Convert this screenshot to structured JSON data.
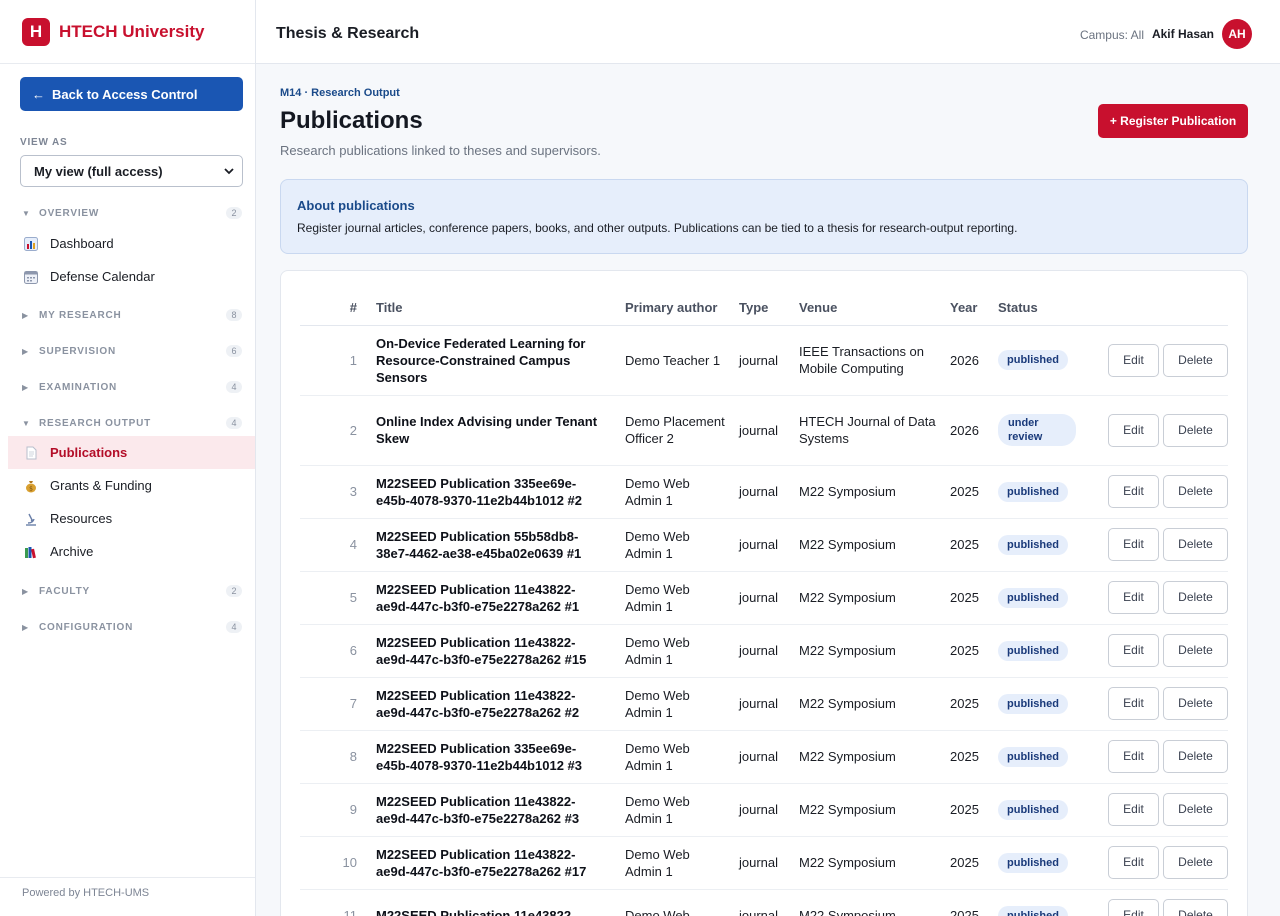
{
  "brand": {
    "logo_letter": "H",
    "name": "HTECH University"
  },
  "sidebar": {
    "back_label": "Back to Access Control",
    "back_arrow": "←",
    "view_as_label": "VIEW AS",
    "view_as_value": "My view (full access)",
    "groups": {
      "overview": {
        "label": "OVERVIEW",
        "count": "2",
        "expanded": true
      },
      "my_research": {
        "label": "MY RESEARCH",
        "count": "8",
        "expanded": false
      },
      "supervision": {
        "label": "SUPERVISION",
        "count": "6",
        "expanded": false
      },
      "examination": {
        "label": "EXAMINATION",
        "count": "4",
        "expanded": false
      },
      "research_output": {
        "label": "RESEARCH OUTPUT",
        "count": "4",
        "expanded": true
      },
      "faculty": {
        "label": "FACULTY",
        "count": "2",
        "expanded": false
      },
      "configuration": {
        "label": "CONFIGURATION",
        "count": "4",
        "expanded": false
      }
    },
    "items": {
      "dashboard": {
        "label": "Dashboard",
        "icon": "bar-chart-icon"
      },
      "defense_calendar": {
        "label": "Defense Calendar",
        "icon": "calendar-icon"
      },
      "publications": {
        "label": "Publications",
        "icon": "document-icon",
        "active": true
      },
      "grants": {
        "label": "Grants & Funding",
        "icon": "money-bag-icon"
      },
      "resources": {
        "label": "Resources",
        "icon": "microscope-icon"
      },
      "archive": {
        "label": "Archive",
        "icon": "books-icon"
      }
    },
    "powered_by": "Powered by HTECH-UMS"
  },
  "topbar": {
    "title": "Thesis & Research",
    "campus": "Campus: All",
    "user_name": "Akif Hasan",
    "avatar_initials": "AH"
  },
  "page": {
    "breadcrumb": "M14 · Research Output",
    "title": "Publications",
    "subtitle": "Research publications linked to theses and supervisors.",
    "register_label": "+ Register Publication"
  },
  "info": {
    "title": "About publications",
    "text": "Register journal articles, conference papers, books, and other outputs. Publications can be tied to a thesis for research-output reporting."
  },
  "table": {
    "headers": {
      "num": "#",
      "title": "Title",
      "author": "Primary author",
      "type": "Type",
      "venue": "Venue",
      "year": "Year",
      "status": "Status"
    },
    "edit_label": "Edit",
    "delete_label": "Delete",
    "rows": [
      {
        "num": "1",
        "title": "On-Device Federated Learning for Resource-Constrained Campus Sensors",
        "author": "Demo Teacher 1",
        "type": "journal",
        "venue": "IEEE Transactions on Mobile Computing",
        "year": "2026",
        "status": "published"
      },
      {
        "num": "2",
        "title": "Online Index Advising under Tenant Skew",
        "author": "Demo Placement Officer 2",
        "type": "journal",
        "venue": "HTECH Journal of Data Systems",
        "year": "2026",
        "status": "under review"
      },
      {
        "num": "3",
        "title": "M22SEED Publication 335ee69e-e45b-4078-9370-11e2b44b1012 #2",
        "author": "Demo Web Admin 1",
        "type": "journal",
        "venue": "M22 Symposium",
        "year": "2025",
        "status": "published"
      },
      {
        "num": "4",
        "title": "M22SEED Publication 55b58db8-38e7-4462-ae38-e45ba02e0639 #1",
        "author": "Demo Web Admin 1",
        "type": "journal",
        "venue": "M22 Symposium",
        "year": "2025",
        "status": "published"
      },
      {
        "num": "5",
        "title": "M22SEED Publication 11e43822-ae9d-447c-b3f0-e75e2278a262 #1",
        "author": "Demo Web Admin 1",
        "type": "journal",
        "venue": "M22 Symposium",
        "year": "2025",
        "status": "published"
      },
      {
        "num": "6",
        "title": "M22SEED Publication 11e43822-ae9d-447c-b3f0-e75e2278a262 #15",
        "author": "Demo Web Admin 1",
        "type": "journal",
        "venue": "M22 Symposium",
        "year": "2025",
        "status": "published"
      },
      {
        "num": "7",
        "title": "M22SEED Publication 11e43822-ae9d-447c-b3f0-e75e2278a262 #2",
        "author": "Demo Web Admin 1",
        "type": "journal",
        "venue": "M22 Symposium",
        "year": "2025",
        "status": "published"
      },
      {
        "num": "8",
        "title": "M22SEED Publication 335ee69e-e45b-4078-9370-11e2b44b1012 #3",
        "author": "Demo Web Admin 1",
        "type": "journal",
        "venue": "M22 Symposium",
        "year": "2025",
        "status": "published"
      },
      {
        "num": "9",
        "title": "M22SEED Publication 11e43822-ae9d-447c-b3f0-e75e2278a262 #3",
        "author": "Demo Web Admin 1",
        "type": "journal",
        "venue": "M22 Symposium",
        "year": "2025",
        "status": "published"
      },
      {
        "num": "10",
        "title": "M22SEED Publication 11e43822-ae9d-447c-b3f0-e75e2278a262 #17",
        "author": "Demo Web Admin 1",
        "type": "journal",
        "venue": "M22 Symposium",
        "year": "2025",
        "status": "published"
      },
      {
        "num": "11",
        "title": "M22SEED Publication 11e43822",
        "author": "Demo Web",
        "type": "journal",
        "venue": "M22 Symposium",
        "year": "2025",
        "status": "published"
      }
    ]
  }
}
